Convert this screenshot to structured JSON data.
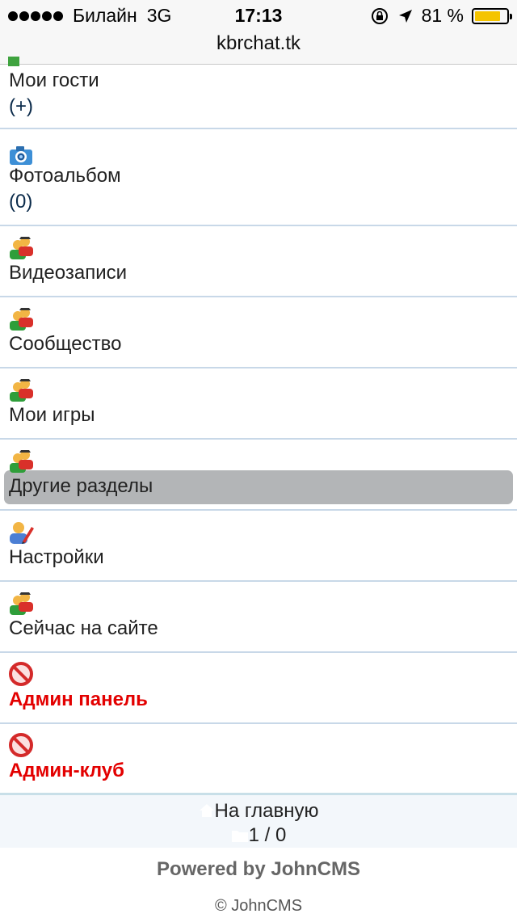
{
  "status_bar": {
    "carrier": "Билайн",
    "network": "3G",
    "time": "17:13",
    "battery_percent": "81 %",
    "battery_level": 0.81,
    "url": "kbrchat.tk"
  },
  "menu": [
    {
      "label": "Мои гости",
      "count": "(+)",
      "icon": "green-user-icon"
    },
    {
      "label": "Фотоальбом",
      "count": " (0)",
      "icon": "camera-icon"
    },
    {
      "label": "Видеозаписи",
      "icon": "users-icon"
    },
    {
      "label": "Сообщество",
      "icon": "users-icon"
    },
    {
      "label": "Мои игры",
      "icon": "users-icon"
    },
    {
      "label": "Другие разделы",
      "icon": "users-icon",
      "highlighted": true
    },
    {
      "label": "Настройки",
      "icon": "user-edit-icon"
    },
    {
      "label": "Сейчас на сайте",
      "icon": "users-icon"
    },
    {
      "label": "Админ панель",
      "icon": "no-entry-icon"
    },
    {
      "label": "Админ-клуб",
      "icon": "no-entry-icon"
    }
  ],
  "footer": {
    "home_link": "На главную",
    "pager": "1 / 0",
    "powered": "Powered by JohnCMS",
    "copyright": "© JohnCMS"
  },
  "colors": {
    "menu_background": "#f0f4f9",
    "admin_text": "#e30000",
    "highlight": "#b3b5b7",
    "battery": "#f5c400"
  }
}
